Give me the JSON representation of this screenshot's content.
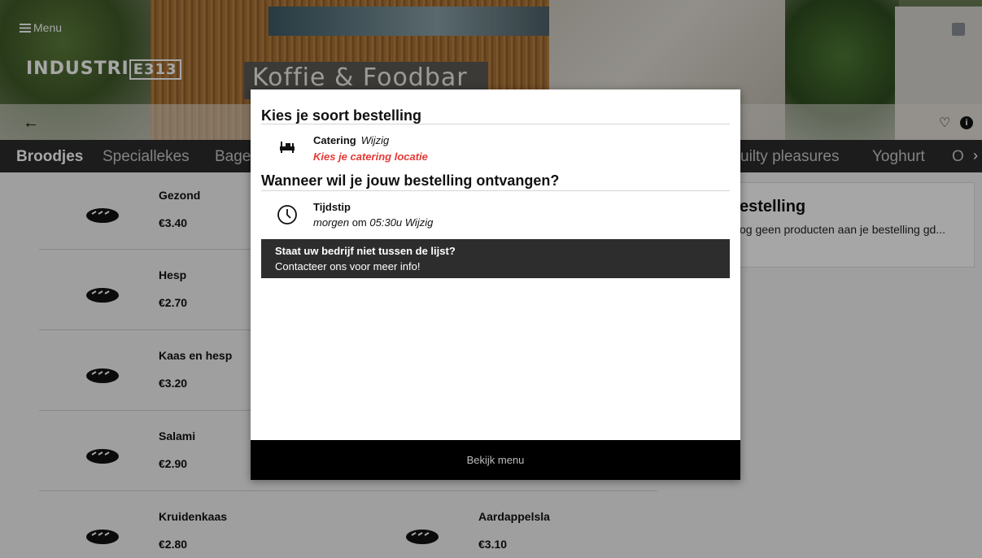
{
  "header": {
    "menu_label": "Menu",
    "logo_main": "INDUSTRI",
    "logo_box": "E313",
    "sign_text": "Koffie & Foodbar"
  },
  "categories": [
    "Broodjes",
    "Speciallekes",
    "Bage",
    "uilty pleasures",
    "Yoghurt",
    "O"
  ],
  "products": [
    {
      "name": "Gezond",
      "price": "€3.40"
    },
    {
      "name": "Hesp",
      "price": "€2.70"
    },
    {
      "name": "Kaas en hesp",
      "price": "€3.20"
    },
    {
      "name": "Salami",
      "price": "€2.90"
    },
    {
      "name": "Kruidenkaas",
      "price": "€2.80"
    },
    {
      "name": "Aardappelsla",
      "price": "€3.10"
    }
  ],
  "cart": {
    "title": "estelling",
    "text": "og geen producten aan je bestelling gd..."
  },
  "modal": {
    "heading_type": "Kies je soort bestelling",
    "type_title": "Catering",
    "type_edit": "Wijzig",
    "type_warning": "Kies je catering locatie",
    "heading_time": "Wanneer wil je jouw bestelling ontvangen?",
    "time_title": "Tijdstip",
    "time_day": "morgen",
    "time_at": "om",
    "time_value": "05:30u",
    "time_edit": "Wijzig",
    "notice_title": "Staat uw bedrijf niet tussen de lijst?",
    "notice_text": "Contacteer ons voor meer info!",
    "button_label": "Bekijk menu"
  },
  "icons": {
    "menu": "hamburger-icon",
    "back": "arrow-left-icon",
    "favorite": "heart-icon",
    "info": "info-icon",
    "catering": "catering-icon",
    "clock": "clock-icon",
    "bread": "bread-icon"
  },
  "colors": {
    "warning": "#e53935",
    "catbar": "#2b2b2b",
    "button": "#000000"
  }
}
